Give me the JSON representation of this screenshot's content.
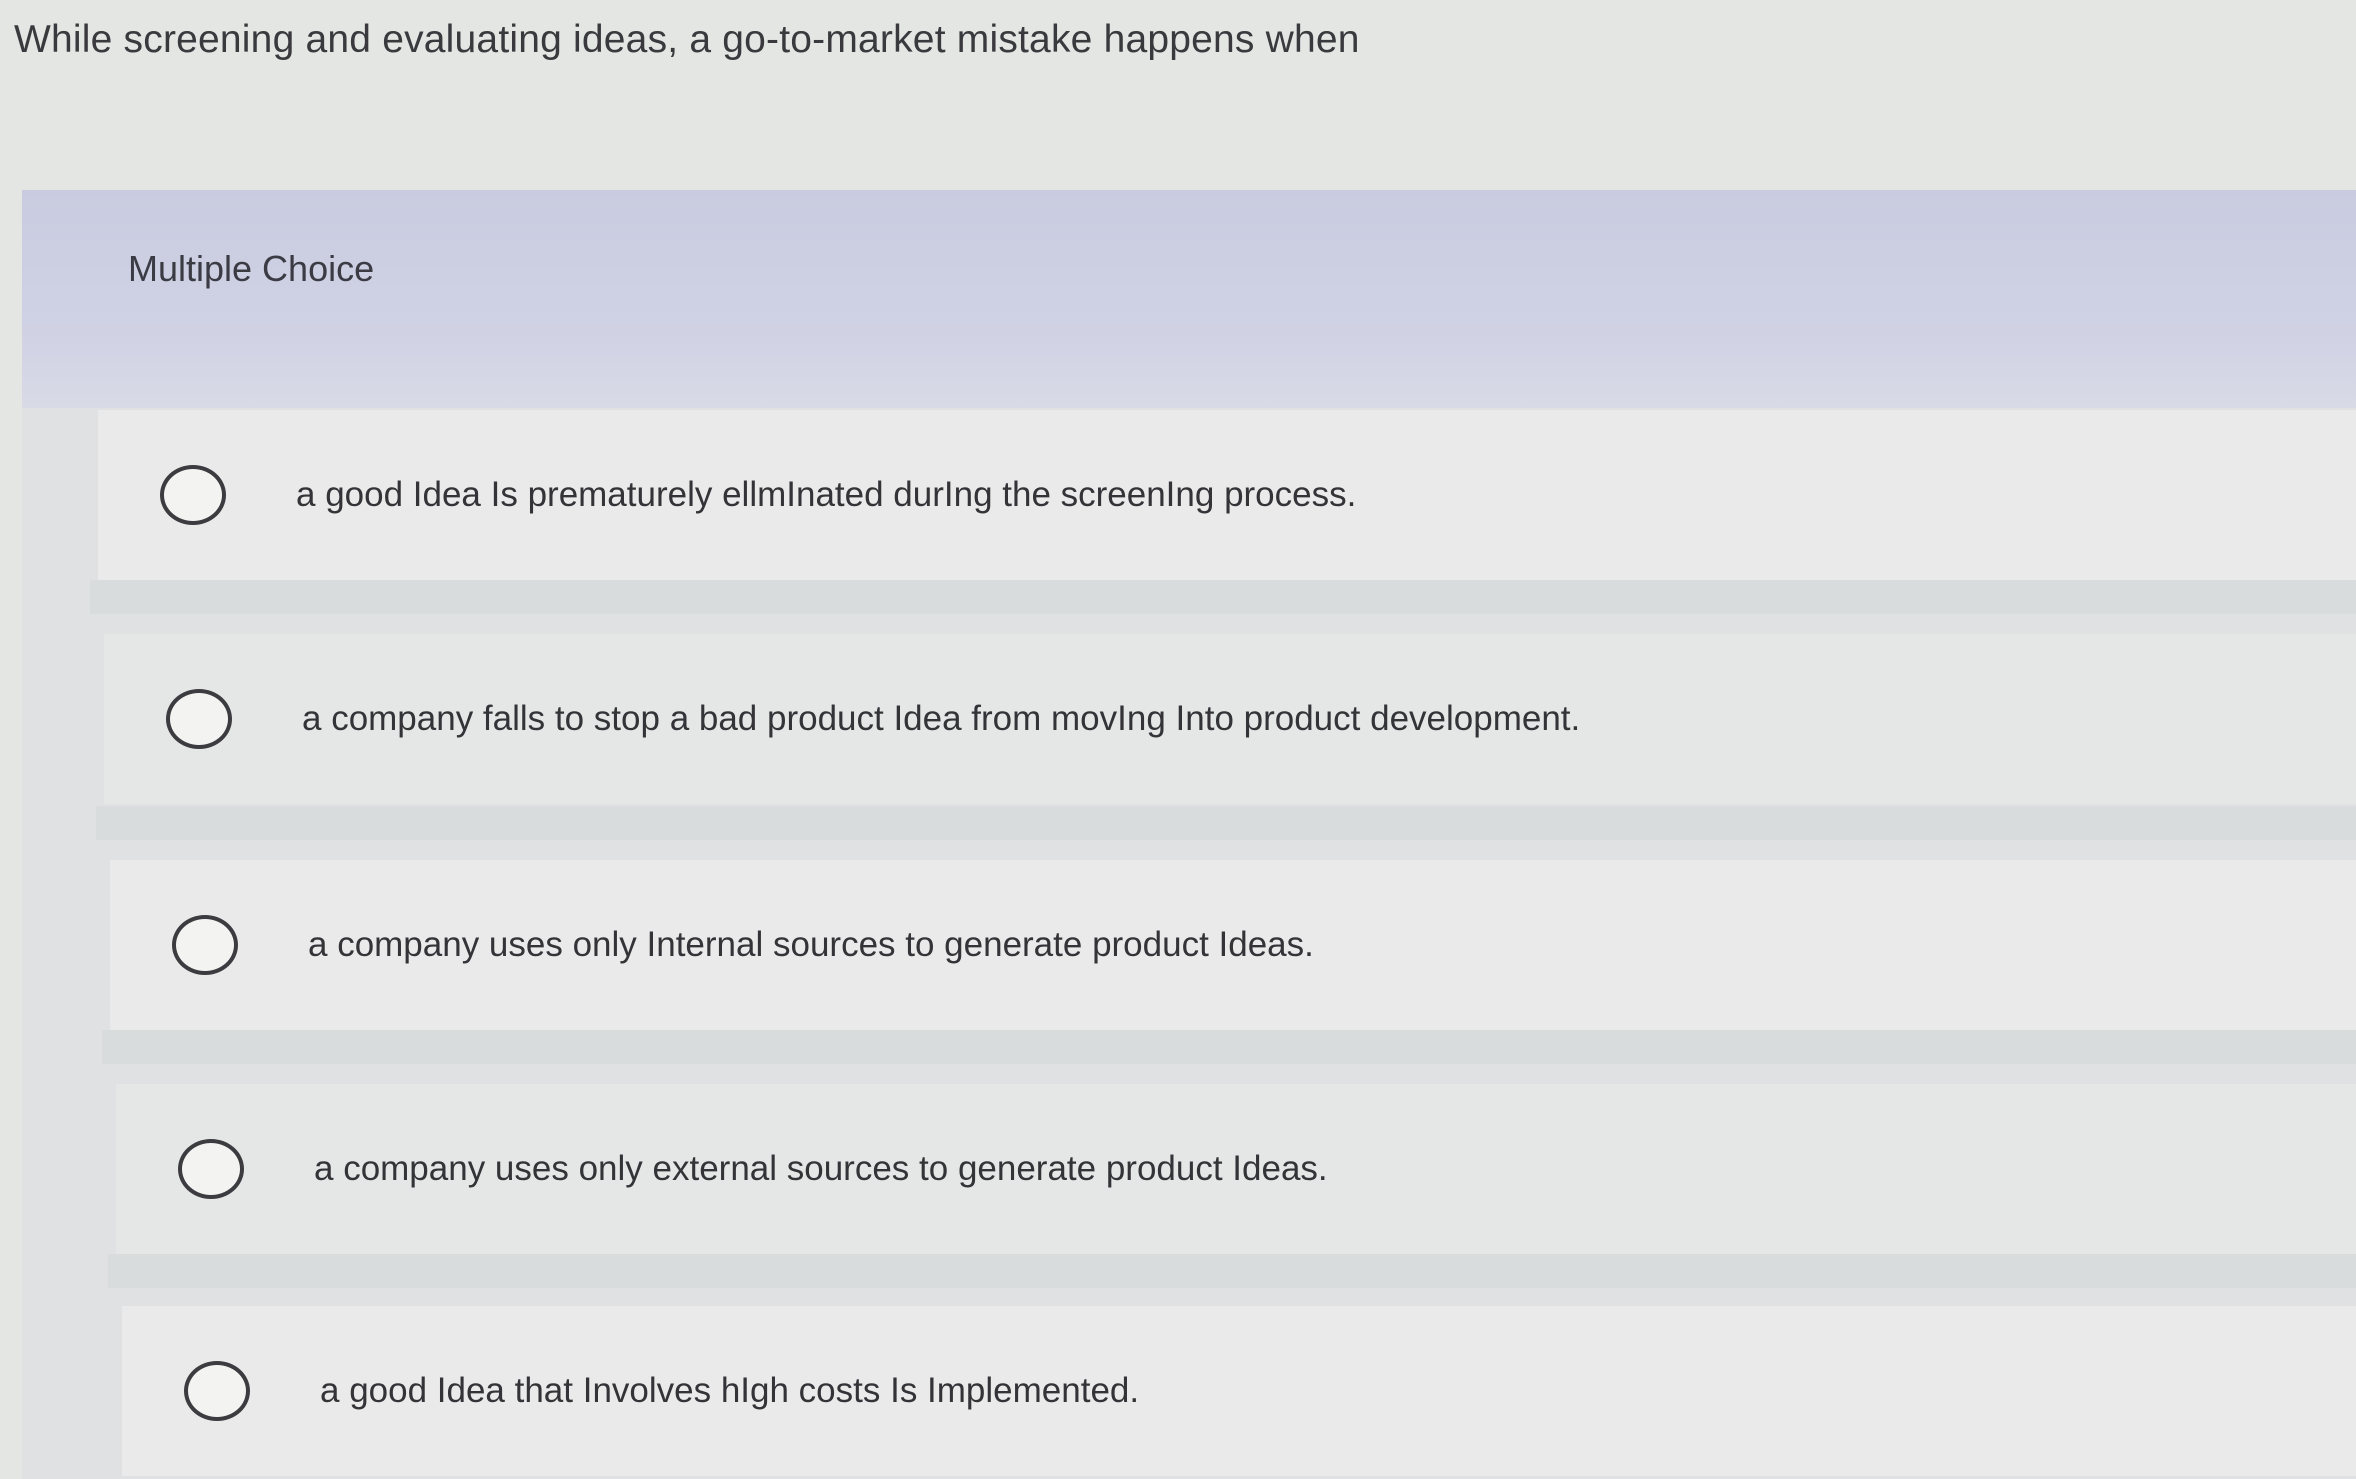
{
  "question": {
    "text": "While screening and evaluating ideas, a go-to-market mistake happens when"
  },
  "panel": {
    "header_label": "Multiple Choice"
  },
  "options": [
    {
      "label": "a good Idea Is prematurely ellmInated durIng the screenIng process."
    },
    {
      "label": "a company falls to stop a bad product Idea from movIng Into product development."
    },
    {
      "label": "a company uses only Internal sources to generate product Ideas."
    },
    {
      "label": "a company uses only external sources to generate product Ideas."
    },
    {
      "label": "a good Idea that Involves hIgh costs Is Implemented."
    }
  ]
}
